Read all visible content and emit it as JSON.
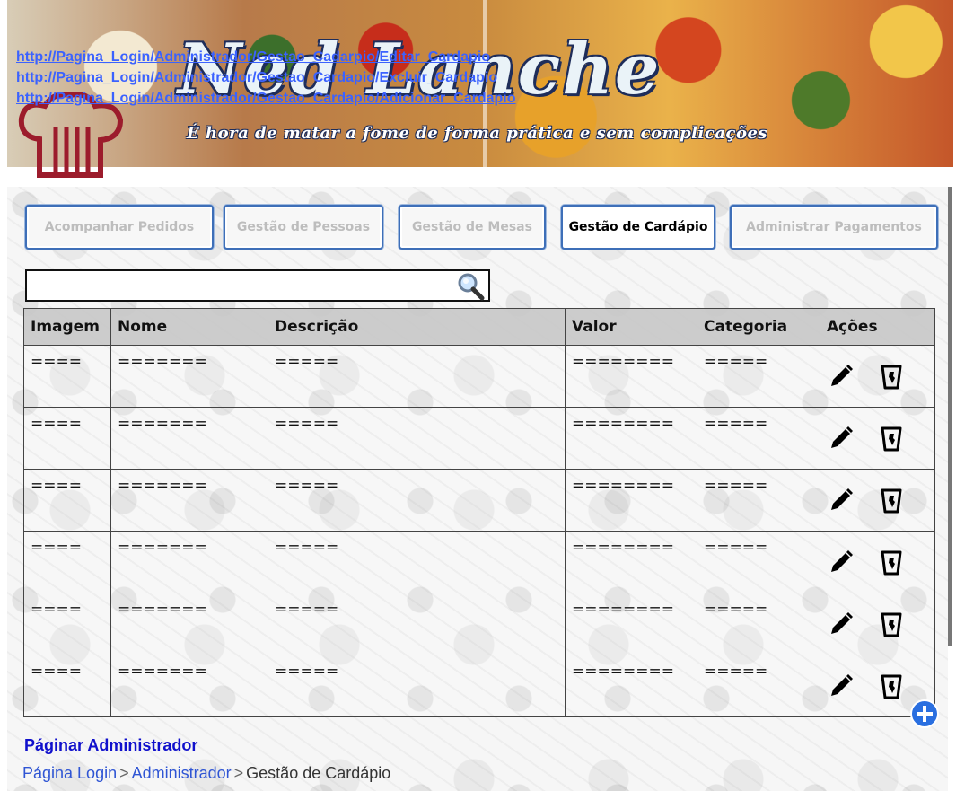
{
  "banner": {
    "title": "Ned Lanche",
    "slogan": "É hora de matar a fome de forma prática e sem complicações",
    "links": [
      "http://Pagina_Login/Administrador/Gestao_Cadarpio/Editar_Cardapio",
      "http://Pagina_Login/Administrador/Gestao_Cardapio/Excluir_Cardapio",
      "http://Pagina_Login/Administrador/Gestao_Cardapio/Adicionar_Cardapio"
    ]
  },
  "tabs": [
    {
      "label": "Acompanhar Pedidos",
      "active": false
    },
    {
      "label": "Gestão de Pessoas",
      "active": false
    },
    {
      "label": "Gestão de Mesas",
      "active": false
    },
    {
      "label": "Gestão de Cardápio",
      "active": true
    },
    {
      "label": "Administrar Pagamentos",
      "active": false
    }
  ],
  "search": {
    "value": "",
    "placeholder": ""
  },
  "table": {
    "headers": [
      "Imagem",
      "Nome",
      "Descrição",
      "Valor",
      "Categoria",
      "Ações"
    ],
    "rows": [
      [
        "====",
        "=======",
        "=====",
        "========",
        "====="
      ],
      [
        "====",
        "=======",
        "=====",
        "========",
        "====="
      ],
      [
        "====",
        "=======",
        "=====",
        "========",
        "====="
      ],
      [
        "====",
        "=======",
        "=====",
        "========",
        "====="
      ],
      [
        "====",
        "=======",
        "=====",
        "========",
        "====="
      ],
      [
        "====",
        "=======",
        "=====",
        "========",
        "====="
      ]
    ]
  },
  "footer": {
    "title": "Páginar Administrador",
    "breadcrumb": [
      {
        "label": "Página Login",
        "link": true
      },
      {
        "label": "Administrador",
        "link": true
      },
      {
        "label": "Gestão de Cardápio",
        "link": false
      }
    ],
    "separator": ">"
  },
  "icons": {
    "edit": "pencil-icon",
    "delete": "trash-icon",
    "add": "plus-circle-icon",
    "search": "magnifier-icon"
  },
  "colors": {
    "tab_border": "#3e6fb8",
    "link": "#3b62ff",
    "footer_title": "#1010cc",
    "add_button": "#2a6fe0"
  }
}
